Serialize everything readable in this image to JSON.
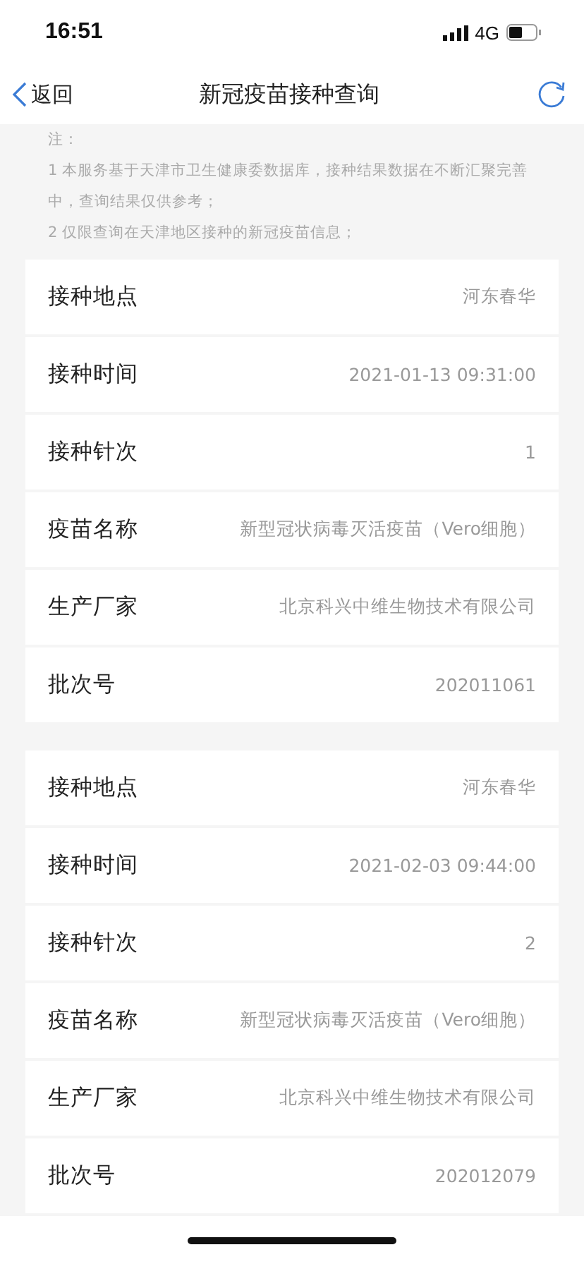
{
  "status_bar": {
    "time": "16:51",
    "network": "4G"
  },
  "nav": {
    "back_label": "返回",
    "title": "新冠疫苗接种查询"
  },
  "notes": [
    "注：",
    "1 本服务基于天津市卫生健康委数据库，接种结果数据在不断汇聚完善中，查询结果仅供参考；",
    "2 仅限查询在天津地区接种的新冠疫苗信息；"
  ],
  "records": [
    {
      "rows": [
        {
          "label": "接种地点",
          "value": "河东春华"
        },
        {
          "label": "接种时间",
          "value": "2021-01-13 09:31:00"
        },
        {
          "label": "接种针次",
          "value": "1"
        },
        {
          "label": "疫苗名称",
          "value": "新型冠状病毒灭活疫苗（Vero细胞）"
        },
        {
          "label": "生产厂家",
          "value": "北京科兴中维生物技术有限公司"
        },
        {
          "label": "批次号",
          "value": "202011061"
        }
      ]
    },
    {
      "rows": [
        {
          "label": "接种地点",
          "value": "河东春华"
        },
        {
          "label": "接种时间",
          "value": "2021-02-03 09:44:00"
        },
        {
          "label": "接种针次",
          "value": "2"
        },
        {
          "label": "疫苗名称",
          "value": "新型冠状病毒灭活疫苗（Vero细胞）"
        },
        {
          "label": "生产厂家",
          "value": "北京科兴中维生物技术有限公司"
        },
        {
          "label": "批次号",
          "value": "202012079"
        }
      ]
    }
  ]
}
